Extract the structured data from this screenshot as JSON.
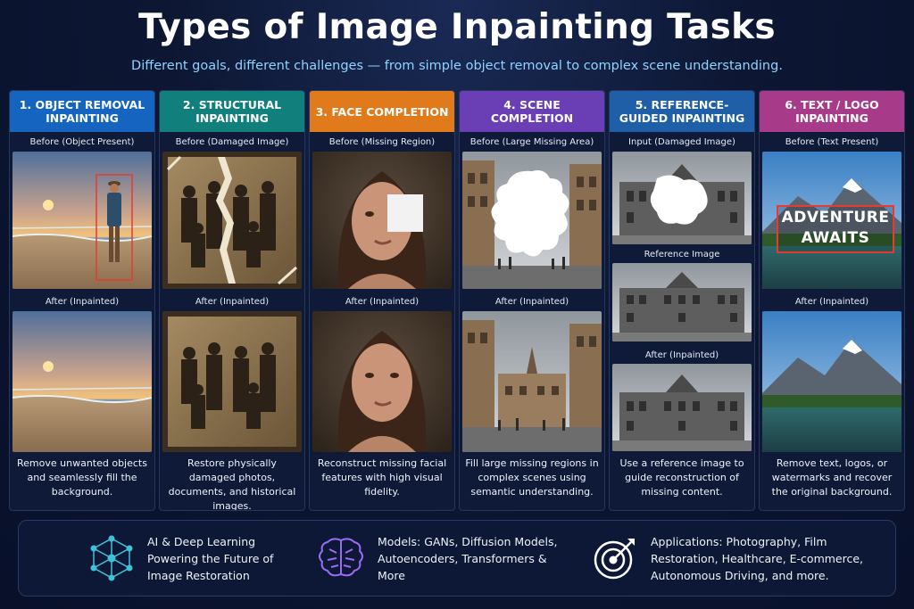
{
  "title": "Types of Image Inpainting Tasks",
  "subtitle": "Different goals, different challenges — from simple object removal to complex scene understanding.",
  "columns": [
    {
      "header": "1. OBJECT REMOVAL INPAINTING",
      "color": "#1565c0",
      "before": "Before (Object Present)",
      "after": "After (Inpainted)",
      "description": "Remove unwanted objects and seamlessly fill the background."
    },
    {
      "header": "2. STRUCTURAL INPAINTING",
      "color": "#11807c",
      "before": "Before (Damaged Image)",
      "after": "After (Inpainted)",
      "description": "Restore physically damaged photos, documents, and historical images."
    },
    {
      "header": "3. FACE COMPLETION",
      "color": "#e07a1a",
      "before": "Before (Missing Region)",
      "after": "After (Inpainted)",
      "description": "Reconstruct missing facial features with high visual fidelity."
    },
    {
      "header": "4. SCENE COMPLETION",
      "color": "#6a3fb5",
      "before": "Before (Large Missing Area)",
      "after": "After (Inpainted)",
      "description": "Fill large missing regions in complex scenes using semantic understanding."
    },
    {
      "header": "5. REFERENCE-GUIDED INPAINTING",
      "color": "#1f5fa8",
      "before": "Input (Damaged Image)",
      "reference": "Reference Image",
      "after": "After (Inpainted)",
      "description": "Use a reference image to guide reconstruction of missing content."
    },
    {
      "header": "6. TEXT / LOGO INPAINTING",
      "color": "#a83a8a",
      "before": "Before (Text Present)",
      "after": "After (Inpainted)",
      "description": "Remove text, logos, or watermarks and recover the original background.",
      "overlay_line1": "ADVENTURE",
      "overlay_line2": "AWAITS"
    }
  ],
  "footer": [
    {
      "icon": "neural-network-icon",
      "text": "AI & Deep Learning Powering the Future of Image Restoration"
    },
    {
      "icon": "brain-icon",
      "text": "Models: GANs, Diffusion Models, Autoencoders, Transformers & More"
    },
    {
      "icon": "target-icon",
      "text": "Applications: Photography, Film Restoration, Healthcare, E-commerce, Autonomous Driving, and more."
    }
  ]
}
